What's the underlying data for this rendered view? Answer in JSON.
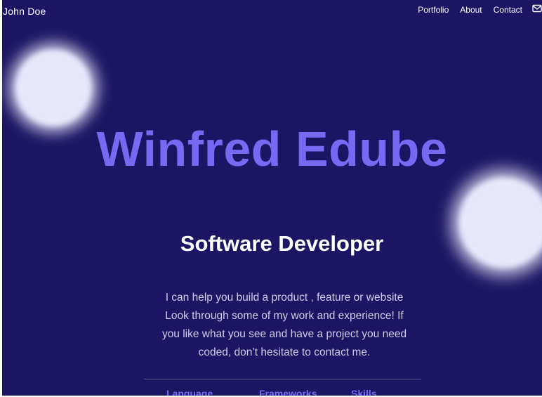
{
  "header": {
    "brand": "John Doe",
    "nav": [
      "Portfolio",
      "About",
      "Contact"
    ],
    "mail_icon": "mail-icon"
  },
  "hero": {
    "name": "Winfred Edube",
    "role": "Software Developer",
    "bio": "I can help you build a product , feature or website Look through some of my work and experience! If you like what you see and have a project you need coded, don’t hesitate to contact me."
  },
  "tabs": [
    "Language",
    "Frameworks",
    "Skills"
  ],
  "colors": {
    "background": "#1b1563",
    "accent": "#7669f2",
    "text": "#ffffff",
    "muted_text": "#cfcde8",
    "blob": "#e8e7fb"
  }
}
